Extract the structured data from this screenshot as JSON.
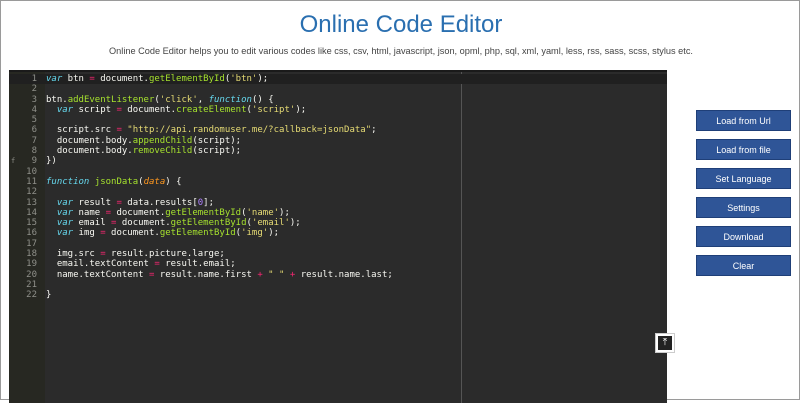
{
  "header": {
    "title": "Online Code Editor",
    "subtitle": "Online Code Editor helps you to edit various codes like css, csv, html, javascript, json, opml, php, sql, xml, yaml, less, rss, sass, scss, stylus etc."
  },
  "editor": {
    "line_numbers": [
      "1",
      "2",
      "3",
      "4",
      "5",
      "6",
      "7",
      "8",
      "9",
      "10",
      "11",
      "12",
      "13",
      "14",
      "15",
      "16",
      "17",
      "18",
      "19",
      "20",
      "21",
      "22"
    ]
  },
  "toolbar": {
    "load_url_label": "Load from Url",
    "load_file_label": "Load from file",
    "set_language_label": "Set Language",
    "settings_label": "Settings",
    "download_label": "Download",
    "clear_label": "Clear"
  },
  "icons": {
    "scroll_top": "scroll-to-top-icon",
    "fold": "fold-arrow-icon"
  },
  "colors": {
    "title": "#2a6fb0",
    "button": "#2f5597",
    "editor_bg": "#2b2b2b"
  }
}
